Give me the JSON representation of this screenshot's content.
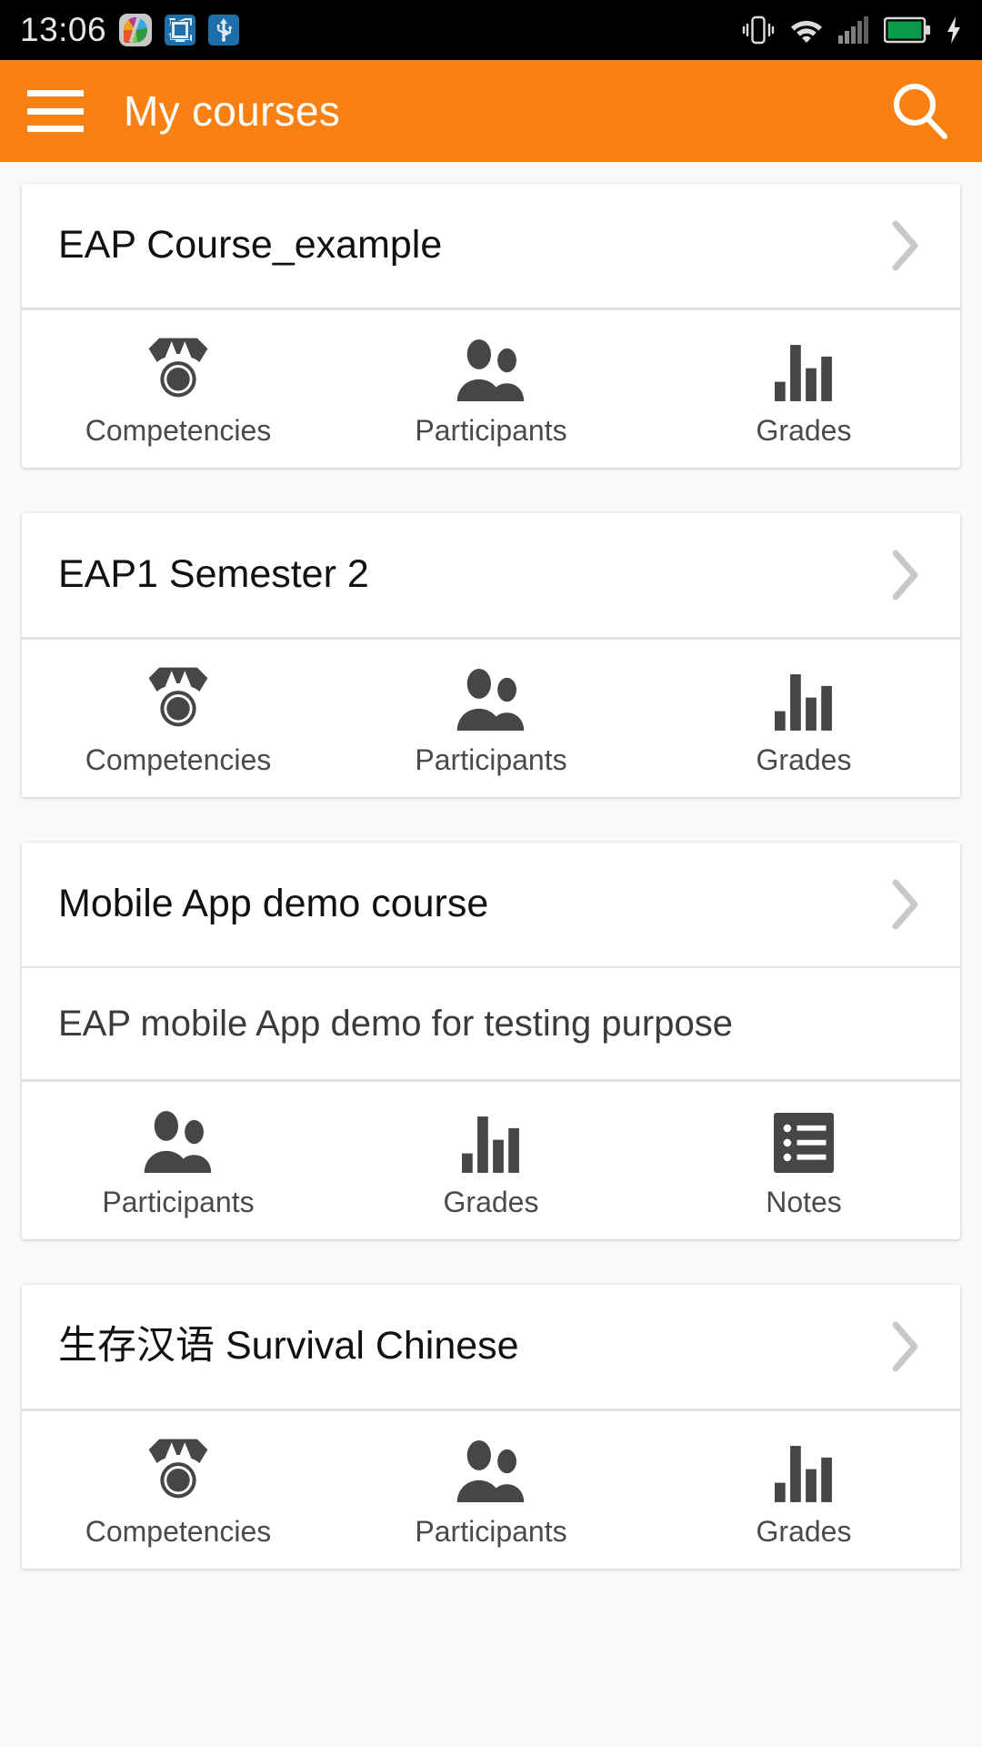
{
  "status_bar": {
    "time": "13:06",
    "left_icons": [
      "app-icon",
      "screenshot-icon",
      "usb-icon"
    ],
    "right_icons": [
      "vibrate-icon",
      "wifi-icon",
      "signal-icon",
      "battery-icon",
      "charging-bolt-icon"
    ],
    "battery_color": "#0b9b4a"
  },
  "app_bar": {
    "menu_icon": "hamburger-menu-icon",
    "title": "My courses",
    "search_icon": "search-icon",
    "background_color": "#f98012"
  },
  "courses": [
    {
      "title": "EAP Course_example",
      "summary": null,
      "chevron": "chevron-right-icon",
      "actions": [
        {
          "label": "Competencies",
          "icon": "medal-icon"
        },
        {
          "label": "Participants",
          "icon": "people-icon"
        },
        {
          "label": "Grades",
          "icon": "bar-chart-icon"
        }
      ]
    },
    {
      "title": "EAP1 Semester 2",
      "summary": null,
      "chevron": "chevron-right-icon",
      "actions": [
        {
          "label": "Competencies",
          "icon": "medal-icon"
        },
        {
          "label": "Participants",
          "icon": "people-icon"
        },
        {
          "label": "Grades",
          "icon": "bar-chart-icon"
        }
      ]
    },
    {
      "title": "Mobile App demo course",
      "summary": "EAP mobile App demo for testing purpose",
      "chevron": "chevron-right-icon",
      "actions": [
        {
          "label": "Participants",
          "icon": "people-icon"
        },
        {
          "label": "Grades",
          "icon": "bar-chart-icon"
        },
        {
          "label": "Notes",
          "icon": "list-notes-icon"
        }
      ]
    },
    {
      "title": "生存汉语 Survival Chinese",
      "summary": null,
      "chevron": "chevron-right-icon",
      "actions": [
        {
          "label": "Competencies",
          "icon": "medal-icon"
        },
        {
          "label": "Participants",
          "icon": "people-icon"
        },
        {
          "label": "Grades",
          "icon": "bar-chart-icon"
        }
      ]
    }
  ]
}
